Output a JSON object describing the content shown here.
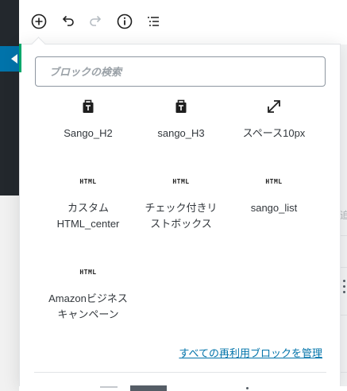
{
  "toolbar": {
    "buttons": [
      {
        "name": "add-block-button",
        "icon": "plus-circle-icon"
      },
      {
        "name": "undo-button",
        "icon": "undo-icon"
      },
      {
        "name": "redo-button",
        "icon": "redo-icon"
      },
      {
        "name": "info-button",
        "icon": "info-icon"
      },
      {
        "name": "outline-button",
        "icon": "list-view-icon"
      }
    ]
  },
  "inserter": {
    "search_placeholder": "ブロックの検索",
    "blocks": [
      {
        "label": "Sango_H2",
        "icon": "reusable-block-icon"
      },
      {
        "label": "sango_H3",
        "icon": "reusable-block-icon"
      },
      {
        "label": "スペース10px",
        "icon": "resize-arrows-icon"
      },
      {
        "label": "カスタム\nHTML_center",
        "icon": "html-icon"
      },
      {
        "label": "チェック付きリ\nストボックス",
        "icon": "html-icon"
      },
      {
        "label": "sango_list",
        "icon": "html-icon"
      },
      {
        "label": "Amazonビジネス\nキャンペーン",
        "icon": "html-icon"
      }
    ],
    "html_icon_text": "HTML",
    "manage_link": "すべての再利用ブロックを管理"
  },
  "background": {
    "partial_text": "追"
  },
  "colors": {
    "accent": "#0073aa",
    "sidebar": "#23282d",
    "green_edge": "#00a86b",
    "text": "#32373c"
  }
}
